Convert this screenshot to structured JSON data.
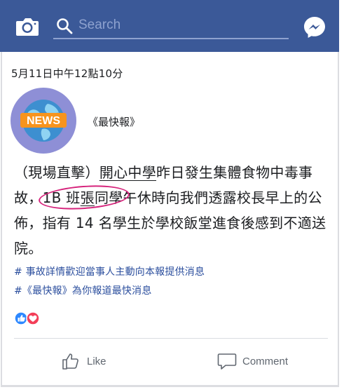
{
  "topbar": {
    "background": "#3b5998",
    "search_placeholder": "Search",
    "icons": [
      "camera-icon",
      "search-icon",
      "messenger-icon"
    ]
  },
  "post": {
    "timestamp": "5月11日中午12點10分",
    "page_name": "《最快報》",
    "avatar_badge": "NEWS",
    "body": {
      "p1": "（現場直擊）",
      "p2_underlined": "開心中學",
      "p3": "昨日發生集體食物中毒事故，",
      "p4_circled_a": "1B 班",
      "p4_circled_b_underlined": "張",
      "p4_circled_c": "同學",
      "p5": "午休時向我們透露校長早上的公佈，指有 14 名學生於學校飯堂進食後感到不適送院。"
    },
    "hashtags": [
      "# 事故詳情歡迎當事人主動向本報提供消息",
      "#《最快報》為你報道最快消息"
    ],
    "reactions": [
      "like-reaction-icon",
      "love-reaction-icon"
    ]
  },
  "actions": {
    "like_label": "Like",
    "comment_label": "Comment"
  },
  "colors": {
    "hashtag": "#2c4f9e",
    "circle_annotation": "#d6247c",
    "action_text": "#606770"
  }
}
